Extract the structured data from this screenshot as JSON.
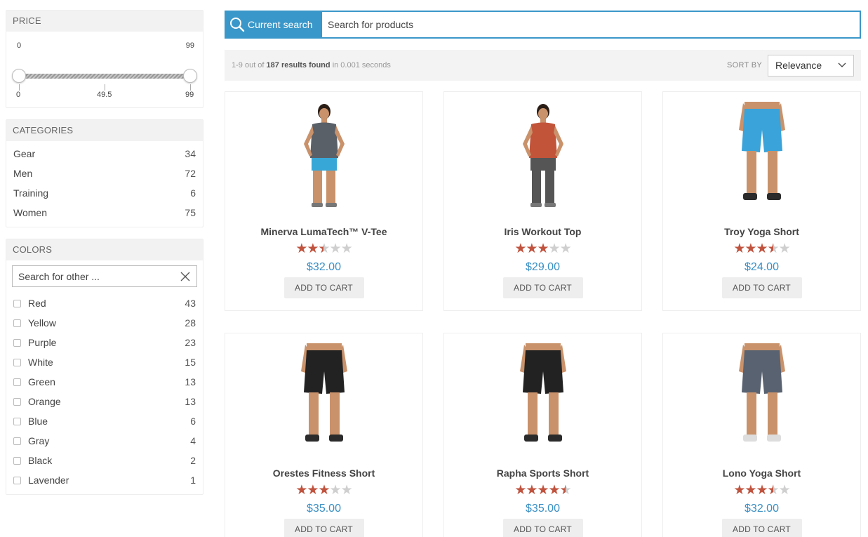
{
  "price": {
    "title": "PRICE",
    "min_value": "0",
    "max_value": "99",
    "ticks": [
      "0",
      "49.5",
      "99"
    ],
    "range_low_fraction": 0.0,
    "range_high_fraction": 1.0
  },
  "categories": {
    "title": "CATEGORIES",
    "items": [
      {
        "label": "Gear",
        "count": "34"
      },
      {
        "label": "Men",
        "count": "72"
      },
      {
        "label": "Training",
        "count": "6"
      },
      {
        "label": "Women",
        "count": "75"
      }
    ]
  },
  "colors": {
    "title": "COLORS",
    "search_placeholder": "Search for other ...",
    "items": [
      {
        "label": "Red",
        "count": "43"
      },
      {
        "label": "Yellow",
        "count": "28"
      },
      {
        "label": "Purple",
        "count": "23"
      },
      {
        "label": "White",
        "count": "15"
      },
      {
        "label": "Green",
        "count": "13"
      },
      {
        "label": "Orange",
        "count": "13"
      },
      {
        "label": "Blue",
        "count": "6"
      },
      {
        "label": "Gray",
        "count": "4"
      },
      {
        "label": "Black",
        "count": "2"
      },
      {
        "label": "Lavender",
        "count": "1"
      }
    ]
  },
  "search": {
    "label": "Current search",
    "placeholder": "Search for products",
    "accent_color": "#3a97c9"
  },
  "stats": {
    "range": "1-9 out of",
    "results": "187 results found",
    "time": "in 0.001 seconds"
  },
  "sort": {
    "label": "SORT BY",
    "selected": "Relevance"
  },
  "products": [
    {
      "name": "Minerva LumaTech™ V-Tee",
      "rating": 2.5,
      "price": "$32.00",
      "cart_label": "ADD TO CART",
      "icon": "woman-tee-icon"
    },
    {
      "name": "Iris Workout Top",
      "rating": 3,
      "price": "$29.00",
      "cart_label": "ADD TO CART",
      "icon": "woman-top-icon"
    },
    {
      "name": "Troy Yoga Short",
      "rating": 3.5,
      "price": "$24.00",
      "cart_label": "ADD TO CART",
      "icon": "man-shorts-blue-icon"
    },
    {
      "name": "Orestes Fitness Short",
      "rating": 3,
      "price": "$35.00",
      "cart_label": "ADD TO CART",
      "icon": "man-shorts-black-icon"
    },
    {
      "name": "Rapha Sports Short",
      "rating": 4.5,
      "price": "$35.00",
      "cart_label": "ADD TO CART",
      "icon": "man-shorts-black-icon"
    },
    {
      "name": "Lono Yoga Short",
      "rating": 3.5,
      "price": "$32.00",
      "cart_label": "ADD TO CART",
      "icon": "man-shorts-gray-icon"
    }
  ],
  "colors_palette": {
    "star_color": "#c0533e",
    "price_color": "#3a8fc4"
  }
}
